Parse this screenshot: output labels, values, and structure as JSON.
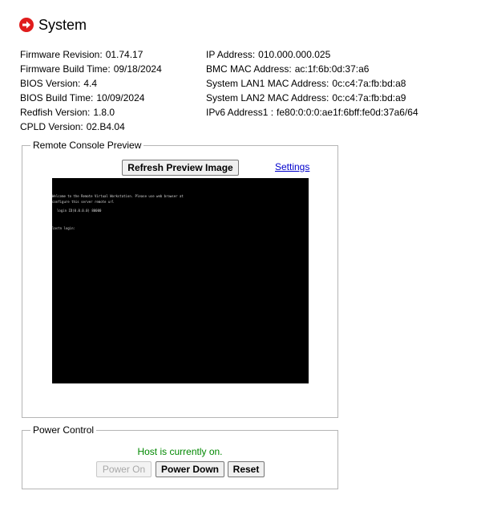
{
  "page": {
    "title": "System",
    "title_icon": "arrow-right-circle-icon",
    "accent_color": "#e01c1c"
  },
  "info_left": [
    {
      "label": "Firmware Revision:",
      "value": "01.74.17"
    },
    {
      "label": "Firmware Build Time:",
      "value": "09/18/2024"
    },
    {
      "label": "BIOS Version:",
      "value": "4.4"
    },
    {
      "label": "BIOS Build Time:",
      "value": "10/09/2024"
    },
    {
      "label": "Redfish Version:",
      "value": "1.8.0"
    },
    {
      "label": "CPLD Version:",
      "value": "02.B4.04"
    }
  ],
  "info_right": [
    {
      "label": "IP Address:",
      "value": "010.000.000.025"
    },
    {
      "label": "BMC MAC Address:",
      "value": "ac:1f:6b:0d:37:a6"
    },
    {
      "label": "System LAN1 MAC Address:",
      "value": "0c:c4:7a:fb:bd:a8"
    },
    {
      "label": "System LAN2 MAC Address:",
      "value": "0c:c4:7a:fb:bd:a9"
    },
    {
      "label": "IPv6 Address1 :",
      "value": "fe80:0:0:0:ae1f:6bff:fe0d:37a6/64"
    }
  ],
  "remote_console": {
    "legend": "Remote Console Preview",
    "refresh_label": "Refresh Preview Image",
    "settings_label": "Settings",
    "console_lines": [
      "Welcome to the Remote Virtual Workstation. Please use web browser at",
      "configure this server   remote url",
      "login  ID(0.0.0.0) 80000",
      "lastn login:"
    ]
  },
  "power_control": {
    "legend": "Power Control",
    "status_text": "Host is currently on.",
    "status_color": "#008800",
    "power_on_label": "Power On",
    "power_down_label": "Power Down",
    "reset_label": "Reset"
  }
}
